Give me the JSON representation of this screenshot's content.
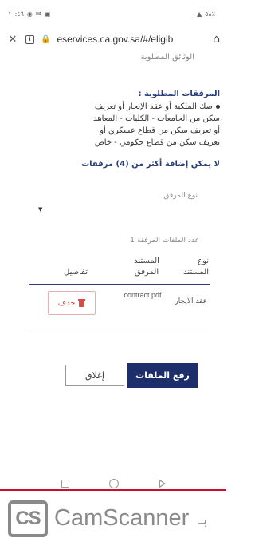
{
  "status_bar": {
    "left_text": "١٠:٤٦",
    "right_text": "٥٨٪"
  },
  "browser": {
    "url": "eservices.ca.gov.sa/#/eligib",
    "icons": [
      "close-icon",
      "info-icon",
      "lock-icon",
      "home-icon"
    ]
  },
  "form": {
    "cropped_heading": "الوثائق المطلوبة",
    "attachments_title": "المرفقات المطلوبة :",
    "attachments_lines": [
      "صك الملكية أو عقد الإيجار أو تعريف",
      "سكن من الجامعات - الكليات - المعاهد",
      "أو تعريف سكن من قطاع عسكري أو",
      "تعريف سكن من قطاع حكومي - خاص"
    ],
    "max_note": "لا يمكن إضافة أكثر من (4) مرفقات",
    "type_label": "نوع المرفق",
    "type_value": "",
    "count_label": "عدد الملفات المرفقة 1"
  },
  "table": {
    "headers": {
      "type": "نوع المستند",
      "doc": "المستند المرفق",
      "details": "تفاصيل"
    },
    "rows": [
      {
        "type": "عقد الايجار",
        "doc": "contract.pdf",
        "delete_label": "حذف"
      }
    ]
  },
  "actions": {
    "upload_label": "رفع الملفات",
    "close_label": "إغلاق"
  },
  "watermark": {
    "logo": "CS",
    "name": "CamScanner",
    "suffix": "بـ"
  },
  "colors": {
    "primary": "#1d2f6b",
    "heading": "#2a3f7a",
    "danger": "#d84a4a"
  }
}
